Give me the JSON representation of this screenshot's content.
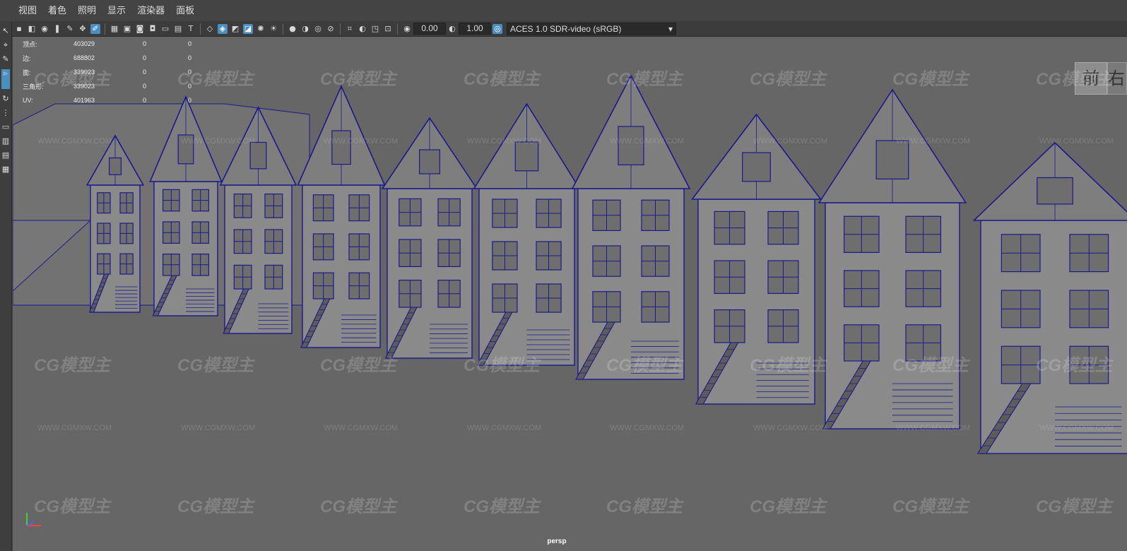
{
  "menubar": [
    "视图",
    "着色",
    "照明",
    "显示",
    "渲染器",
    "面板"
  ],
  "toolbar": {
    "icons_group1": [
      "camera-icon",
      "film-icon",
      "snapshot-icon",
      "bookmark-icon",
      "grease-pencil-icon",
      "2d-pan-icon",
      "paint-icon"
    ],
    "icons_group2": [
      "grid-icon",
      "film-gate-icon",
      "resolution-gate-icon",
      "gate-mask-icon",
      "field-chart-icon",
      "safe-action-icon",
      "safe-title-icon"
    ],
    "icons_group3": [
      "wireframe-icon",
      "smooth-shade-icon",
      "wireframe-on-shaded-icon",
      "textured-icon",
      "lights-icon",
      "shadows-icon"
    ],
    "icons_group4": [
      "ambient-occlusion-icon",
      "motion-blur-icon",
      "anti-alias-icon",
      "depth-of-field-icon"
    ],
    "icons_group5": [
      "isolate-icon",
      "xray-icon",
      "xray-joints-icon",
      "backface-icon"
    ],
    "exposure_value": "0.00",
    "gamma_value": "1.00",
    "color_space": "ACES 1.0 SDR-video (sRGB)"
  },
  "hud": {
    "rows": [
      {
        "label": "顶点:",
        "v1": "403029",
        "v2": "0",
        "v3": "0"
      },
      {
        "label": "边:",
        "v1": "688802",
        "v2": "0",
        "v3": "0"
      },
      {
        "label": "面:",
        "v1": "339023",
        "v2": "0",
        "v3": "0"
      },
      {
        "label": "三角形:",
        "v1": "339023",
        "v2": "0",
        "v3": "0"
      },
      {
        "label": "UV:",
        "v1": "401963",
        "v2": "0",
        "v3": "0"
      }
    ]
  },
  "viewcube": {
    "front_label": "前",
    "side_label": "右"
  },
  "camera": "persp",
  "watermark": {
    "text": "CG模型主",
    "url": "WWW.CGMXW.COM"
  },
  "colors": {
    "wire": "#1a1a8c",
    "house": "#8a8a8a",
    "roof": "#7e7e7e",
    "viewport": "#666666",
    "accent": "#4a8fc0"
  }
}
